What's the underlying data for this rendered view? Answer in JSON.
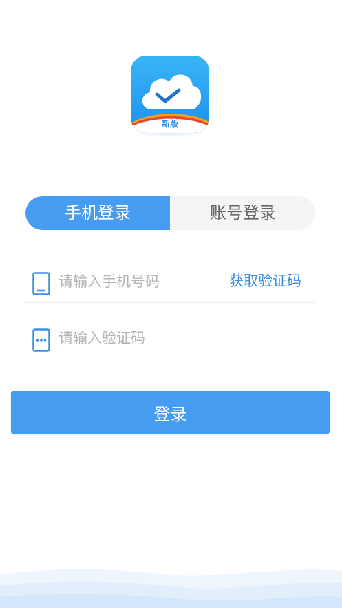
{
  "logo": {
    "badge": "新版",
    "icon": "cloud-check-icon",
    "colors": {
      "top": "#39b5f6",
      "bottom": "#1e8ff0",
      "stripe_orange": "#f4a21b",
      "stripe_red": "#e8472b"
    }
  },
  "tabs": [
    {
      "label": "手机登录",
      "active": true
    },
    {
      "label": "账号登录",
      "active": false
    }
  ],
  "phone_field": {
    "placeholder": "请输入手机号码",
    "value": "",
    "icon": "phone-icon"
  },
  "get_code_label": "获取验证码",
  "code_field": {
    "placeholder": "请输入验证码",
    "value": "",
    "icon": "message-dots-icon"
  },
  "login_label": "登录",
  "colors": {
    "accent": "#469cf0",
    "link": "#3b8fe6",
    "placeholder": "#b3b3b3",
    "tab_inactive_bg": "#f5f5f5"
  }
}
